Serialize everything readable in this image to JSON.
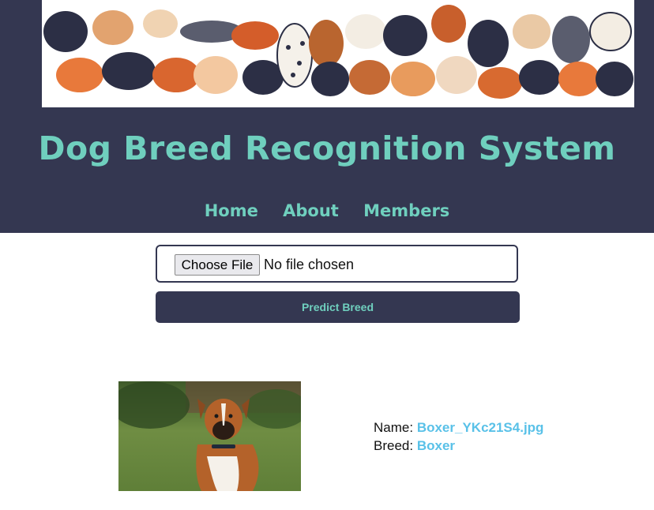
{
  "header": {
    "title": "Dog Breed Recognition System",
    "nav": [
      {
        "label": "Home"
      },
      {
        "label": "About"
      },
      {
        "label": "Members"
      }
    ]
  },
  "upload": {
    "choose_label": "Choose File",
    "status": "No file chosen",
    "predict_label": "Predict Breed"
  },
  "result": {
    "name_label": "Name:",
    "name_value": "Boxer_YKc21S4.jpg",
    "breed_label": "Breed:",
    "breed_value": "Boxer"
  },
  "colors": {
    "header_bg": "#343751",
    "accent": "#6fcfbe",
    "result_value": "#59c1e8"
  }
}
